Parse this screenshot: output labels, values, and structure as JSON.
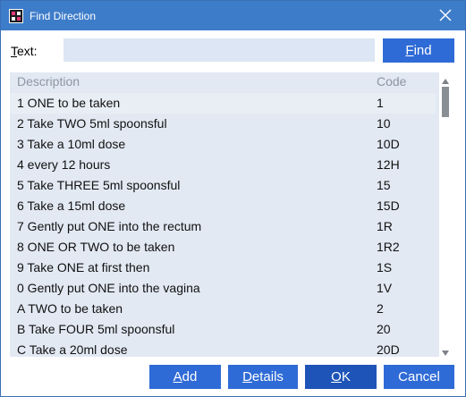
{
  "window": {
    "title": "Find Direction",
    "colors": {
      "titlebar": "#3d7cc9",
      "button": "#2f6bd6",
      "list_bg": "#e2e9f3"
    }
  },
  "search": {
    "label_hotkey": "T",
    "label_rest": "ext:",
    "value": "",
    "find_hotkey": "F",
    "find_rest": "ind"
  },
  "table": {
    "headers": {
      "description": "Description",
      "code": "Code"
    },
    "rows": [
      {
        "description": "1 ONE to be taken",
        "code": "1",
        "selected": true
      },
      {
        "description": "2 Take TWO 5ml spoonsful",
        "code": "10"
      },
      {
        "description": "3 Take a 10ml dose",
        "code": "10D"
      },
      {
        "description": "4 every 12 hours",
        "code": "12H"
      },
      {
        "description": "5 Take THREE 5ml spoonsful",
        "code": "15"
      },
      {
        "description": "6 Take a 15ml dose",
        "code": "15D"
      },
      {
        "description": "7 Gently put ONE into the rectum",
        "code": "1R"
      },
      {
        "description": "8 ONE OR TWO to be taken",
        "code": "1R2"
      },
      {
        "description": "9 Take ONE at first then",
        "code": "1S"
      },
      {
        "description": "0 Gently put ONE into the vagina",
        "code": "1V"
      },
      {
        "description": "A TWO to be taken",
        "code": "2"
      },
      {
        "description": "B Take FOUR 5ml spoonsful",
        "code": "20"
      },
      {
        "description": "C Take a 20ml dose",
        "code": "20D"
      }
    ]
  },
  "buttons": {
    "add_hotkey": "A",
    "add_rest": "dd",
    "details_hotkey": "D",
    "details_rest": "etails",
    "ok_hotkey": "O",
    "ok_rest": "K",
    "cancel": "Cancel"
  },
  "icons": {
    "app": "app-icon",
    "close": "close-icon",
    "scroll_up": "scroll-up-arrow-icon",
    "scroll_down": "scroll-down-arrow-icon"
  }
}
